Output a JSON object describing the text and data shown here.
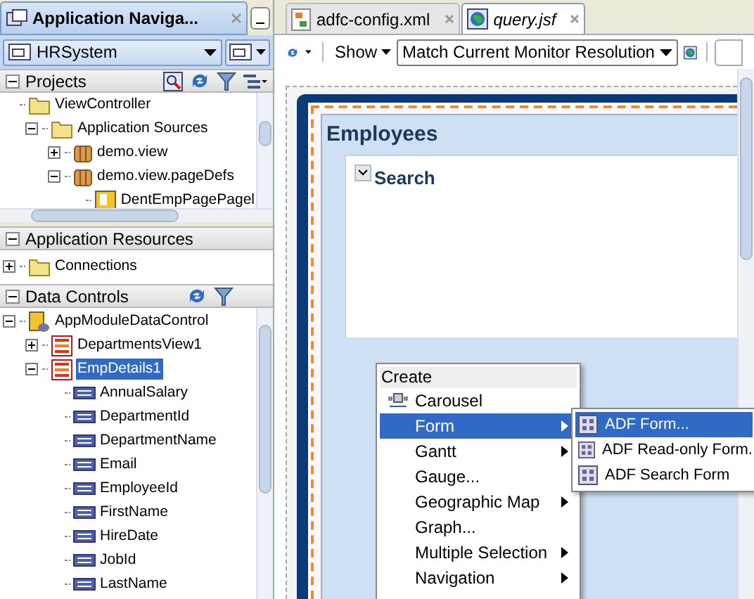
{
  "navigator": {
    "title": "Application Naviga...",
    "application": "HRSystem",
    "projects": {
      "title": "Projects",
      "tree": [
        {
          "label": "ViewController",
          "kind": "folder",
          "children": [
            {
              "label": "Application Sources",
              "kind": "folder",
              "expanded": true,
              "children": [
                {
                  "label": "demo.view",
                  "kind": "package",
                  "expanded": false
                },
                {
                  "label": "demo.view.pageDefs",
                  "kind": "package",
                  "expanded": true,
                  "children": [
                    {
                      "label": "DentEmpPagePagel",
                      "kind": "pagedef"
                    }
                  ]
                }
              ]
            }
          ]
        }
      ]
    },
    "resources": {
      "title": "Application Resources",
      "tree": [
        {
          "label": "Connections",
          "kind": "folder",
          "expanded": false
        }
      ]
    },
    "data_controls": {
      "title": "Data Controls",
      "tree": [
        {
          "label": "AppModuleDataControl",
          "kind": "datacontrol",
          "expanded": true,
          "children": [
            {
              "label": "DepartmentsView1",
              "kind": "collection",
              "expanded": false,
              "selected": false
            },
            {
              "label": "EmpDetails1",
              "kind": "collection",
              "expanded": true,
              "selected": true,
              "children": [
                {
                  "label": "AnnualSalary",
                  "kind": "attribute"
                },
                {
                  "label": "DepartmentId",
                  "kind": "attribute"
                },
                {
                  "label": "DepartmentName",
                  "kind": "attribute"
                },
                {
                  "label": "Email",
                  "kind": "attribute"
                },
                {
                  "label": "EmployeeId",
                  "kind": "attribute"
                },
                {
                  "label": "FirstName",
                  "kind": "attribute"
                },
                {
                  "label": "HireDate",
                  "kind": "attribute"
                },
                {
                  "label": "JobId",
                  "kind": "attribute"
                },
                {
                  "label": "LastName",
                  "kind": "attribute"
                }
              ]
            }
          ]
        }
      ]
    }
  },
  "editor_tabs": [
    {
      "label": "adfc-config.xml",
      "kind": "diagram",
      "selected": false
    },
    {
      "label": "query.jsf",
      "kind": "page",
      "selected": true
    }
  ],
  "toolbar": {
    "show": "Show",
    "resolution": "Match Current Monitor Resolution"
  },
  "canvas": {
    "heading": "Employees",
    "panel_title": "Search"
  },
  "context_menu": {
    "title": "Create",
    "items": [
      {
        "label": "Carousel",
        "kind": "icon",
        "submenu": false,
        "selected": false
      },
      {
        "label": "Form",
        "kind": "plain",
        "submenu": true,
        "selected": true
      },
      {
        "label": "Gantt",
        "kind": "plain",
        "submenu": true,
        "selected": false
      },
      {
        "label": "Gauge...",
        "kind": "plain",
        "submenu": false,
        "selected": false
      },
      {
        "label": "Geographic Map",
        "kind": "plain",
        "submenu": true,
        "selected": false
      },
      {
        "label": "Graph...",
        "kind": "plain",
        "submenu": false,
        "selected": false
      },
      {
        "label": "Multiple Selection",
        "kind": "plain",
        "submenu": true,
        "selected": false
      },
      {
        "label": "Navigation",
        "kind": "plain",
        "submenu": true,
        "selected": false
      }
    ]
  },
  "submenu": [
    {
      "label": "ADF Form...",
      "selected": true
    },
    {
      "label": "ADF Read-only Form.",
      "selected": false
    },
    {
      "label": "ADF Search Form",
      "selected": false
    }
  ]
}
